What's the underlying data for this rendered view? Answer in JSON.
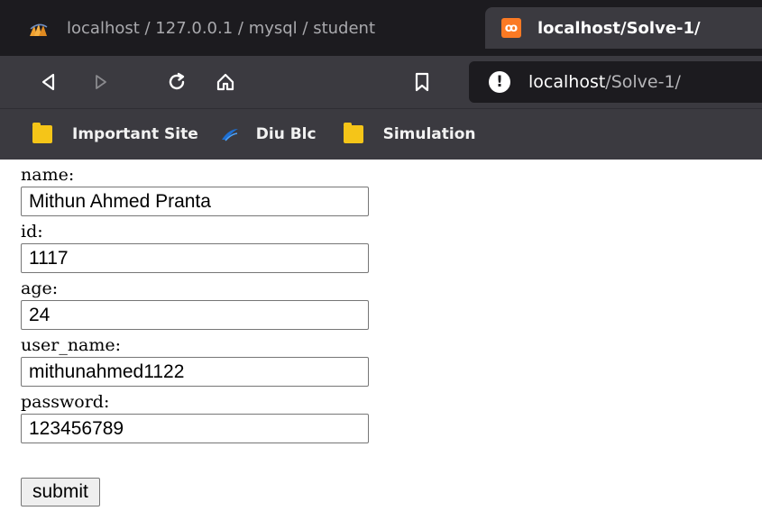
{
  "tabs": [
    {
      "title": "localhost / 127.0.0.1 / mysql / student",
      "icon": "phpmyadmin-icon",
      "active": false
    },
    {
      "title": "localhost/Solve-1/",
      "icon": "xampp-icon",
      "active": true
    }
  ],
  "xampp_icon_glyph": "ꝏ",
  "address_bar": {
    "host": "localhost",
    "path": "/Solve-1/"
  },
  "bookmarks": [
    {
      "label": "Important Site",
      "icon": "folder-icon"
    },
    {
      "label": "Diu Blc",
      "icon": "diu-blc-icon"
    },
    {
      "label": "Simulation",
      "icon": "folder-icon"
    }
  ],
  "form": {
    "fields": [
      {
        "label": "name:",
        "value": "Mithun Ahmed Pranta"
      },
      {
        "label": "id:",
        "value": "1117"
      },
      {
        "label": "age:",
        "value": "24"
      },
      {
        "label": "user_name:",
        "value": "mithunahmed1122"
      },
      {
        "label": "password:",
        "value": "123456789"
      }
    ],
    "submit_label": "submit"
  },
  "colors": {
    "chrome_dark": "#1c1b1f",
    "chrome_toolbar": "#3b3a40",
    "folder_yellow": "#f5c518",
    "xampp_orange": "#fb7a24"
  }
}
